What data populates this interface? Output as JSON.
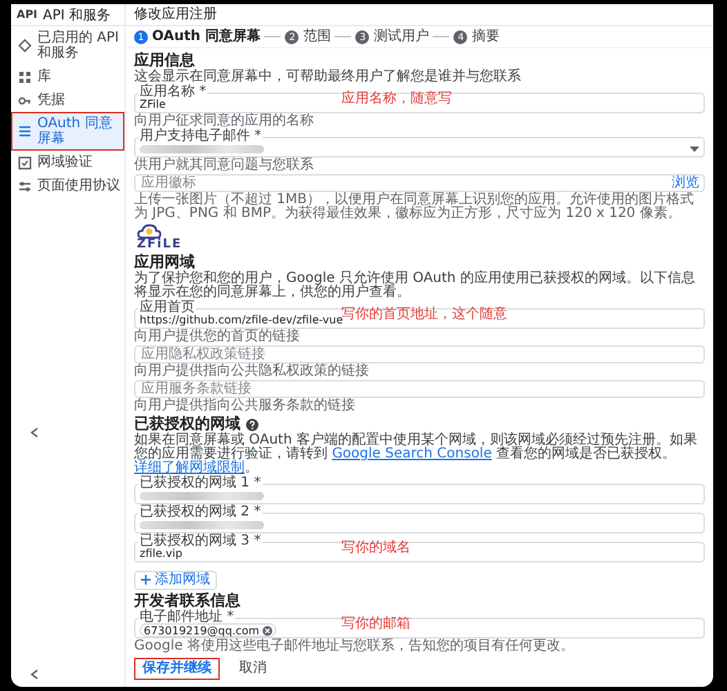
{
  "app": {
    "logo": "API",
    "title": "API 和服务"
  },
  "sidebar": {
    "items": [
      {
        "label": "已启用的 API 和服务",
        "selected": false,
        "highlighted": false
      },
      {
        "label": "库",
        "selected": false,
        "highlighted": false
      },
      {
        "label": "凭据",
        "selected": false,
        "highlighted": false
      },
      {
        "label": "OAuth 同意屏幕",
        "selected": true,
        "highlighted": true
      },
      {
        "label": "网域验证",
        "selected": false,
        "highlighted": false
      },
      {
        "label": "页面使用协议",
        "selected": false,
        "highlighted": false
      }
    ]
  },
  "page_title": "修改应用注册",
  "steps": [
    {
      "number": "1",
      "label": "OAuth 同意屏幕",
      "selected": true
    },
    {
      "number": "2",
      "label": "范围",
      "selected": false
    },
    {
      "number": "3",
      "label": "测试用户",
      "selected": false
    },
    {
      "number": "4",
      "label": "摘要",
      "selected": false
    }
  ],
  "sections": [
    {
      "heading": "应用信息",
      "description": [
        {
          "kind": "text",
          "text": "这会显示在同意屏幕中，可帮助最终用户了解您是谁并与您联系"
        }
      ],
      "items": [
        {
          "kind": "field",
          "label": "应用名称 *",
          "value": "ZFile",
          "note": "应用名称，随意写",
          "help": "向用户征求同意的应用的名称"
        },
        {
          "kind": "select",
          "label": "用户支持电子邮件 *",
          "redacted": true,
          "help": "供用户就其同意问题与您联系"
        },
        {
          "kind": "file",
          "placeholder": "应用徽标",
          "button": "浏览",
          "help": "上传一张图片（不超过 1MB），以便用户在同意屏幕上识别您的应用。允许使用的图片格式为 JPG、PNG 和 BMP。为获得最佳效果，徽标应为正方形，尺寸应为 120 x 120 像素。"
        },
        {
          "kind": "logo",
          "text": "ZFiLE"
        }
      ]
    },
    {
      "heading": "应用网域",
      "description": [
        {
          "kind": "text",
          "text": "为了保护您和您的用户，Google 只允许使用 OAuth 的应用使用已获授权的网域。以下信息将显示在您的同意屏幕上，供您的用户查看。"
        }
      ],
      "items": [
        {
          "kind": "field",
          "label": "应用首页",
          "value": "https://github.com/zfile-dev/zfile-vue",
          "note": "写你的首页地址，这个随意",
          "help": "向用户提供您的首页的链接"
        },
        {
          "kind": "empty",
          "placeholder": "应用隐私权政策链接",
          "help": "向用户提供指向公共隐私权政策的链接"
        },
        {
          "kind": "empty",
          "placeholder": "应用服务条款链接",
          "help": "向用户提供指向公共服务条款的链接"
        }
      ]
    },
    {
      "heading": "已获授权的网域",
      "help_icon": true,
      "description": [
        {
          "kind": "text",
          "text": "如果在同意屏幕或 OAuth 客户端的配置中使用某个网域，则该网域必须经过预先注册。如果您的应用需要进行验证，请转到 "
        },
        {
          "kind": "link",
          "text": "Google Search Console"
        },
        {
          "kind": "text",
          "text": " 查看您的网域是否已获授权。"
        },
        {
          "kind": "link",
          "text": "详细了解网域限制"
        },
        {
          "kind": "text",
          "text": "。"
        }
      ],
      "items": [
        {
          "kind": "field",
          "label": "已获授权的网域 1 *",
          "redacted": true
        },
        {
          "kind": "field",
          "label": "已获授权的网域 2 *",
          "redacted": true
        },
        {
          "kind": "field",
          "label": "已获授权的网域 3 *",
          "value": "zfile.vip",
          "note": "写你的域名"
        },
        {
          "kind": "add",
          "label": "添加网域"
        }
      ]
    },
    {
      "heading": "开发者联系信息",
      "items": [
        {
          "kind": "chips",
          "label": "电子邮件地址 *",
          "chips": [
            "673019219@qq.com"
          ],
          "note": "写你的邮箱",
          "help": "Google 将使用这些电子邮件地址与您联系，告知您的项目有任何更改。"
        }
      ]
    }
  ],
  "actions": [
    {
      "label": "保存并继续",
      "kind": "primary",
      "highlighted": true
    },
    {
      "label": "取消",
      "kind": "plain",
      "highlighted": false
    }
  ]
}
